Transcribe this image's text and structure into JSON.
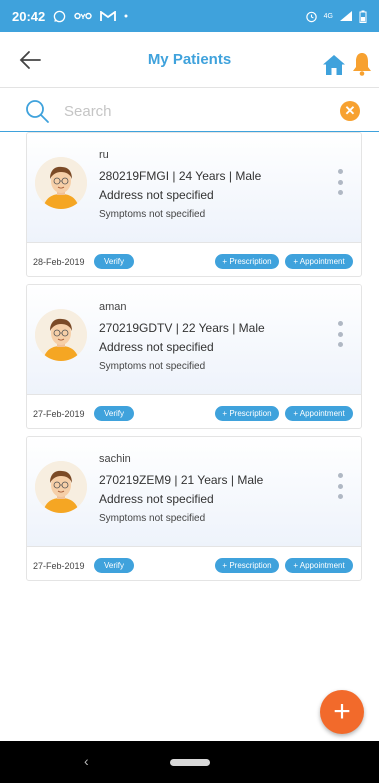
{
  "status_bar": {
    "time": "20:42",
    "network": "4G",
    "colors": {
      "background": "#3fa2dc"
    }
  },
  "header": {
    "title": "My Patients",
    "back_icon": "arrow-left-icon",
    "home_icon": "home-icon",
    "bell_icon": "bell-icon"
  },
  "search": {
    "value": "",
    "placeholder": "Search",
    "clear_icon": "close-icon"
  },
  "patients": [
    {
      "name": "ru",
      "info": "280219FMGI | 24 Years | Male",
      "address": "Address not specified",
      "symptoms": "Symptoms not specified",
      "date": "28-Feb-2019",
      "verify_label": "Verify",
      "prescription_label": "+ Prescription",
      "appointment_label": "+ Appointment"
    },
    {
      "name": "aman",
      "info": "270219GDTV | 22 Years | Male",
      "address": "Address not specified",
      "symptoms": "Symptoms not specified",
      "date": "27-Feb-2019",
      "verify_label": "Verify",
      "prescription_label": "+ Prescription",
      "appointment_label": "+ Appointment"
    },
    {
      "name": "sachin",
      "info": "270219ZEM9 | 21 Years | Male",
      "address": "Address not specified",
      "symptoms": "Symptoms not specified",
      "date": "27-Feb-2019",
      "verify_label": "Verify",
      "prescription_label": "+ Prescription",
      "appointment_label": "+ Appointment"
    }
  ],
  "fab": {
    "label": "+",
    "icon": "plus-icon"
  },
  "colors": {
    "accent": "#3fa2dc",
    "orange": "#f7a130",
    "fab": "#f26a2b"
  }
}
